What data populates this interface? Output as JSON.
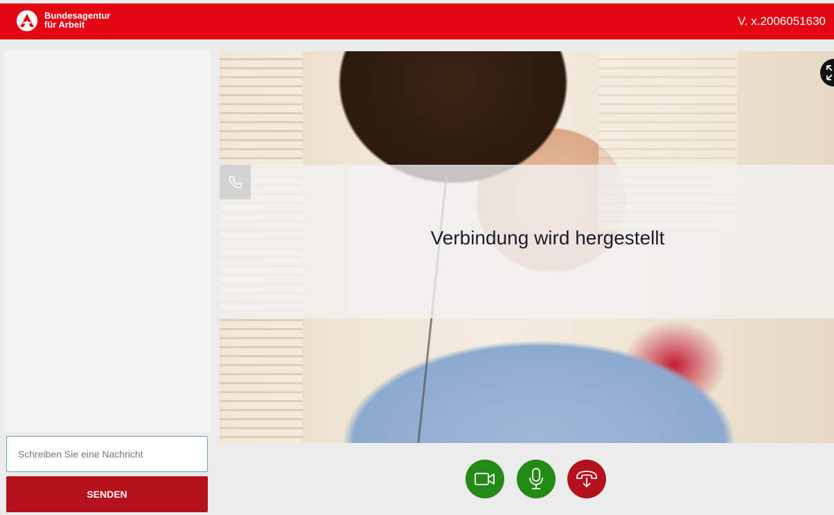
{
  "header": {
    "brand_line1": "Bundesagentur",
    "brand_line2": "für Arbeit",
    "version": "V. x.2006051630"
  },
  "chat": {
    "input_placeholder": "Schreiben Sie eine Nachricht",
    "send_label": "SENDEN"
  },
  "video": {
    "status_text": "Verbindung wird hergestellt"
  },
  "controls": {
    "camera": "camera-icon",
    "microphone": "microphone-icon",
    "hangup": "hang-up-icon"
  },
  "colors": {
    "brand_red": "#e30613",
    "send_red": "#b4111c",
    "control_green": "#238a16",
    "hangup_red": "#b4111c"
  }
}
